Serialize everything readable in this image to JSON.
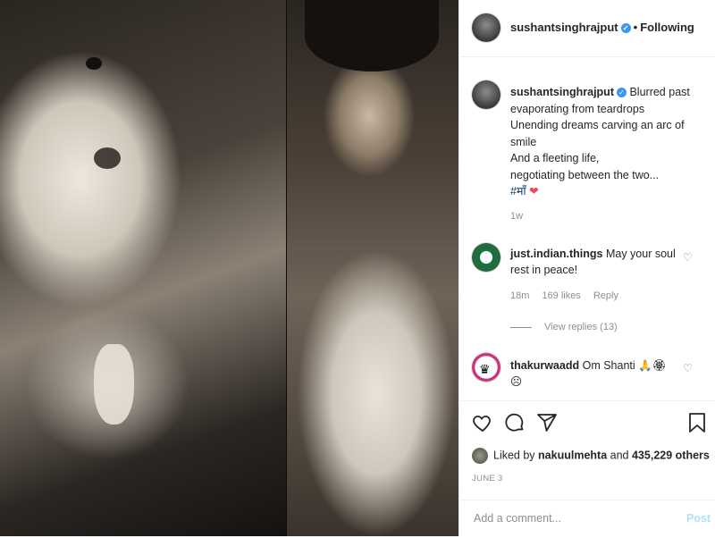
{
  "header": {
    "username": "sushantsinghrajput",
    "separator": "•",
    "follow_status": "Following"
  },
  "caption": {
    "username": "sushantsinghrajput",
    "lines": [
      "Blurred past",
      "evaporating from teardrops",
      "Unending dreams carving an arc of",
      "smile",
      "And a fleeting life,",
      "negotiating between the two..."
    ],
    "hashtag": "#माँ",
    "emoji": "❤",
    "age": "1w"
  },
  "comments": [
    {
      "username": "just.indian.things",
      "text": "May your soul rest in peace!",
      "age": "18m",
      "likes": "169 likes",
      "reply": "Reply",
      "view_replies": "View replies (13)"
    },
    {
      "username": "thakurwaadd",
      "text": "Om Shanti 🙏🏵",
      "emoji_line": "☹"
    }
  ],
  "actions": {
    "like_icon": "heart-icon",
    "comment_icon": "comment-icon",
    "share_icon": "share-icon",
    "save_icon": "bookmark-icon"
  },
  "likes": {
    "prefix": "Liked by",
    "user": "nakuulmehta",
    "middle": "and",
    "count": "435,229 others"
  },
  "date": "JUNE 3",
  "add_comment": {
    "placeholder": "Add a comment...",
    "post_label": "Post"
  }
}
